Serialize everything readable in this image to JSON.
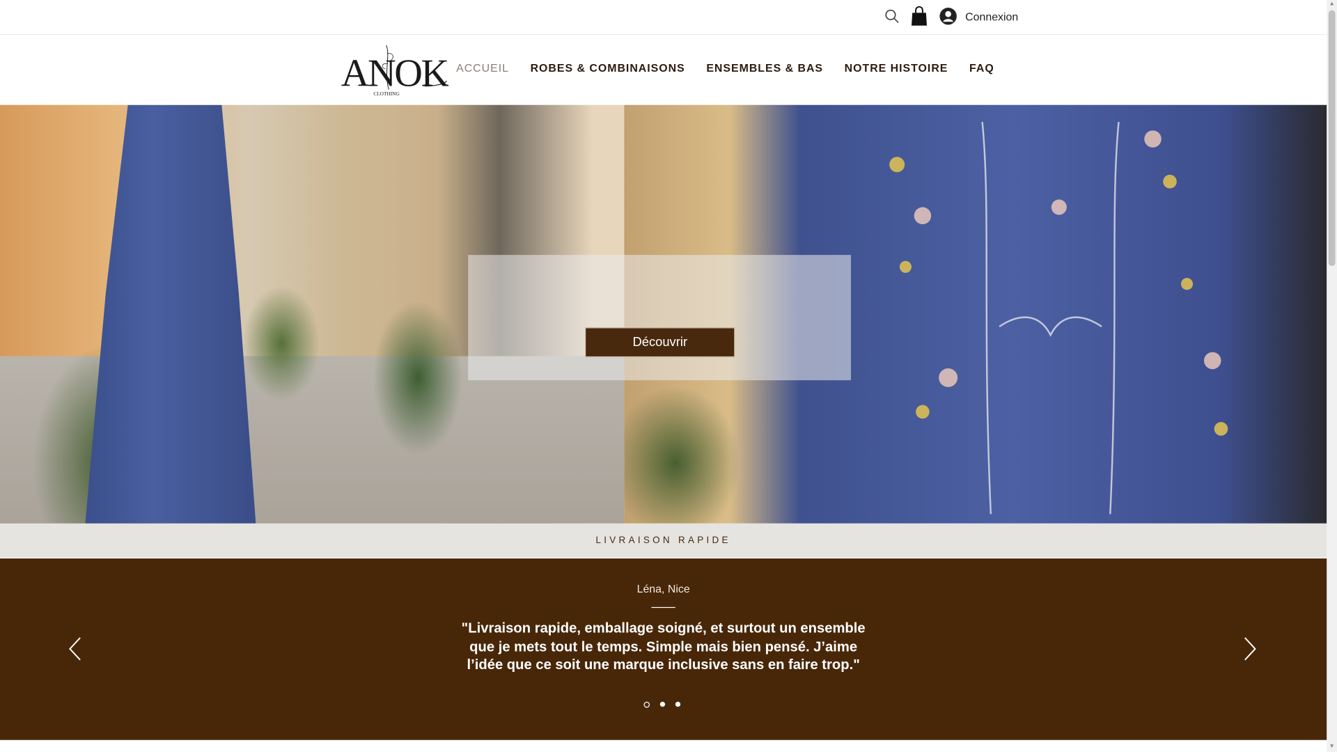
{
  "topbar": {
    "search_icon": "search-icon",
    "cart_icon": "shopping-bag-icon",
    "login_icon": "user-avatar-icon",
    "login_label": "Connexion"
  },
  "header": {
    "logo_text": "ANOK",
    "logo_subtext": "CLOTHING",
    "nav": [
      {
        "label": "ACCUEIL",
        "active": true
      },
      {
        "label": "ROBES & COMBINAISONS",
        "active": false
      },
      {
        "label": "ENSEMBLES & BAS",
        "active": false
      },
      {
        "label": "NOTRE HISTOIRE",
        "active": false
      },
      {
        "label": "FAQ",
        "active": false
      }
    ]
  },
  "hero": {
    "cta_label": "Découvrir"
  },
  "strip": {
    "text": "LIVRAISON RAPIDE"
  },
  "testimonial": {
    "author": "Léna, Nice",
    "quote": "\"Livraison rapide, emballage soigné, et surtout un ensemble que je mets tout le temps. Simple mais bien pensé. J’aime l’idée que ce soit une marque inclusive sans en faire trop.\"",
    "prev_icon": "chevron-left-icon",
    "next_icon": "chevron-right-icon",
    "slides": 3,
    "active_slide": 1
  },
  "colors": {
    "brand_brown": "#482709",
    "nav_text": "#2d1b0e",
    "nav_active": "#8b7f76",
    "strip_bg": "#e6e4e0"
  }
}
